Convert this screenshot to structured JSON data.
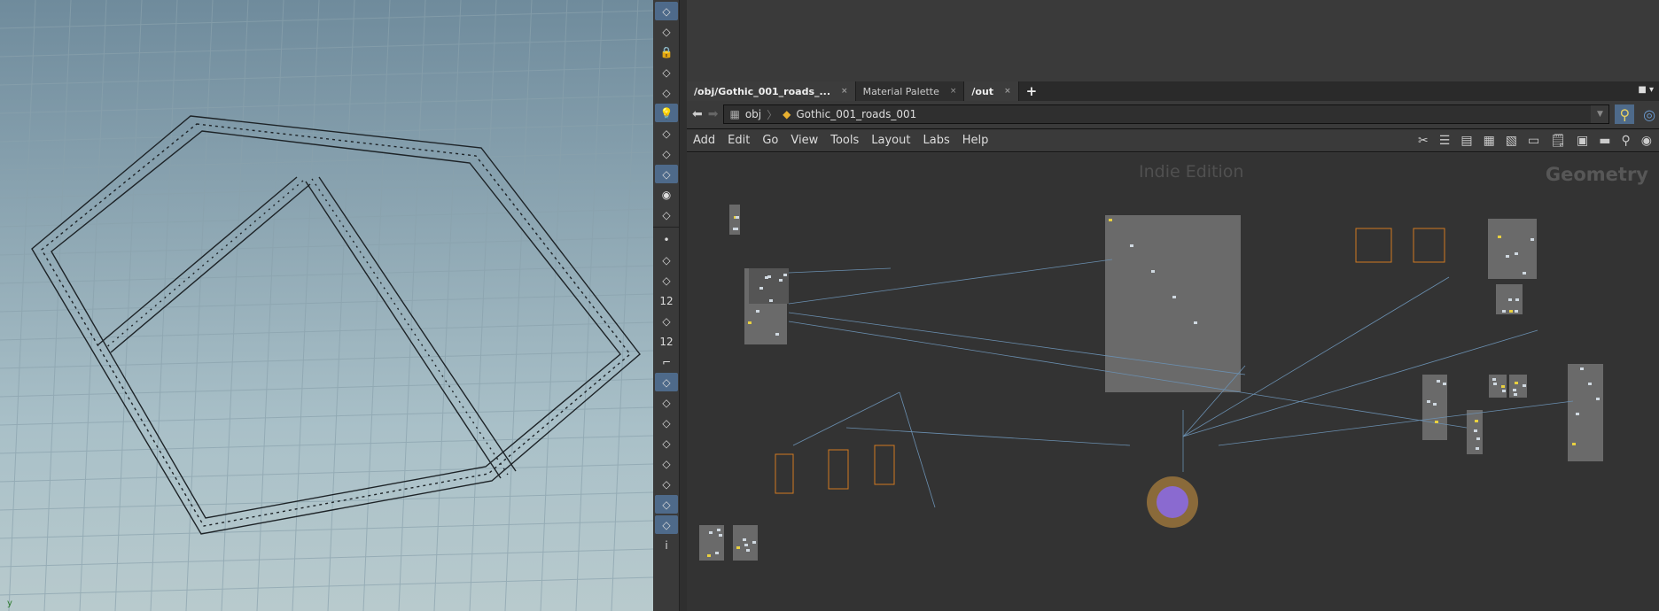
{
  "viewport": {
    "axis_label": "y"
  },
  "toolbar": {
    "tools": [
      {
        "icon": "view-icon",
        "on": true
      },
      {
        "icon": "geometry-view-icon"
      },
      {
        "icon": "lock-icon"
      },
      {
        "icon": "ghost-icon"
      },
      {
        "icon": "sphere-icon"
      },
      {
        "icon": "light-icon",
        "on": true
      },
      {
        "icon": "add-light-icon"
      },
      {
        "icon": "spot-light-icon"
      },
      {
        "icon": "shaded-icon",
        "on": true
      },
      {
        "icon": "camera-icon"
      },
      {
        "icon": "camera-alt-icon"
      },
      {
        "icon": "point-icon"
      },
      {
        "icon": "normal-icon"
      },
      {
        "icon": "point-normal-icon"
      },
      {
        "icon": "point-number-icon",
        "glyph": "12"
      },
      {
        "icon": "prim-icon"
      },
      {
        "icon": "prim-number-icon",
        "glyph": "12"
      },
      {
        "icon": "edge-icon"
      },
      {
        "icon": "prim-normal-icon",
        "on": true
      },
      {
        "icon": "uv-icon"
      },
      {
        "icon": "template-icon"
      },
      {
        "icon": "uv-boundary-icon"
      },
      {
        "icon": "origin-icon"
      },
      {
        "icon": "background-icon"
      },
      {
        "icon": "image-icon",
        "on": true
      },
      {
        "icon": "pin-icon",
        "on": true
      },
      {
        "icon": "info-icon",
        "glyph": "i"
      }
    ]
  },
  "tabs": [
    {
      "label": "/obj/Gothic_001_roads_..."
    },
    {
      "label": "Material Palette"
    },
    {
      "label": "/out"
    }
  ],
  "tab_close": "×",
  "tab_add": "+",
  "path": {
    "root": "obj",
    "node": "Gothic_001_roads_001"
  },
  "menu": [
    "Add",
    "Edit",
    "Go",
    "View",
    "Tools",
    "Layout",
    "Labs",
    "Help"
  ],
  "network": {
    "watermark": "Indie Edition",
    "context": "Geometry"
  }
}
